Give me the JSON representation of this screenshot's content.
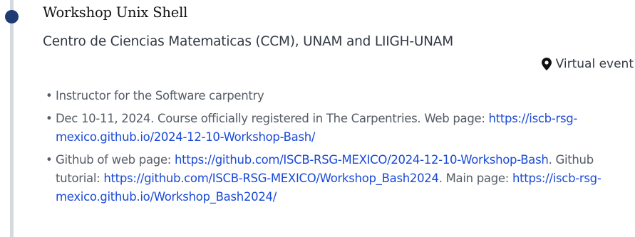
{
  "entry": {
    "title": "Workshop Unix Shell",
    "institution": "Centro de Ciencias Matematicas (CCM), UNAM and LIIGH-UNAM",
    "location_icon": "map-marker-icon",
    "location": "Virtual event"
  },
  "bullets": {
    "b1": {
      "text": "Instructor for the Software carpentry"
    },
    "b2": {
      "text": "Dec 10-11, 2024. Course officially registered in The Carpentries. Web page: ",
      "link": "https://iscb-rsg-mexico.github.io/2024-12-10-Workshop-Bash/"
    },
    "b3": {
      "text1": "Github of web page: ",
      "link1": "https://github.com/ISCB-RSG-MEXICO/2024-12-10-Workshop-Bash",
      "text2": ". Github tutorial: ",
      "link2": "https://github.com/ISCB-RSG-MEXICO/Workshop_Bash2024",
      "text3": ". Main page: ",
      "link3": "https://iscb-rsg-mexico.github.io/Workshop_Bash2024/"
    }
  },
  "colors": {
    "timeline_dot": "#203a73",
    "timeline_line": "#d4d9e0",
    "link": "#1a4ad8"
  }
}
